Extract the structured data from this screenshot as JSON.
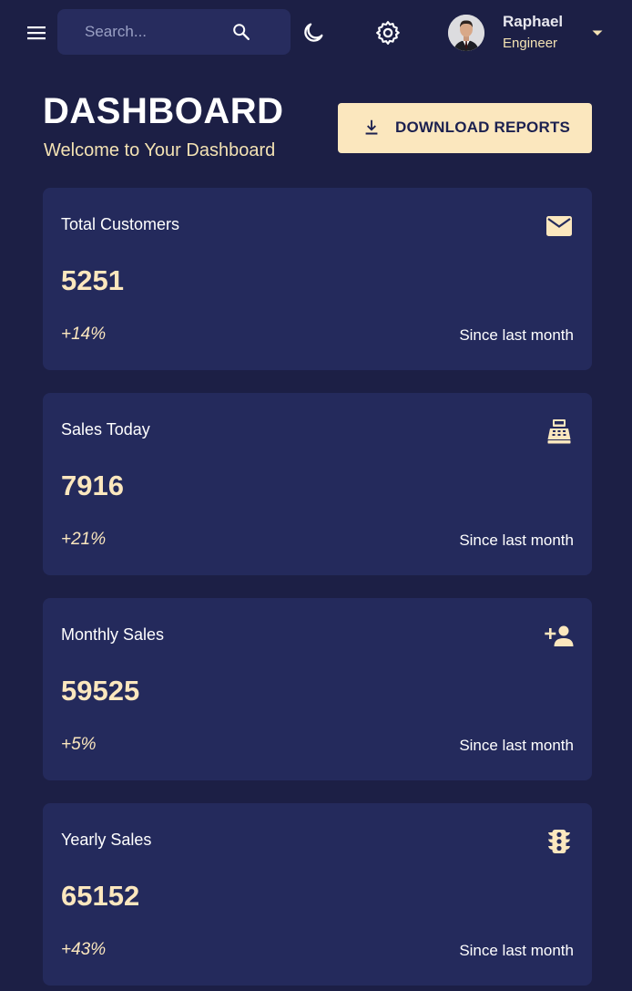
{
  "colors": {
    "background": "#1c1f45",
    "card": "#242a5c",
    "search_bg": "#272c5e",
    "accent": "#fbe7be",
    "accent_text": "#1c2150",
    "text": "#ffffff"
  },
  "topbar": {
    "menu_icon": "hamburger-menu-icon",
    "search": {
      "placeholder": "Search...",
      "value": "",
      "icon": "search-icon"
    },
    "theme_icon": "moon-icon",
    "settings_icon": "gear-icon",
    "profile": {
      "name": "Raphael",
      "role": "Engineer",
      "avatar_icon": "avatar",
      "caret_icon": "caret-down-icon"
    }
  },
  "header": {
    "title": "DASHBOARD",
    "subtitle": "Welcome to Your Dashboard",
    "download_button": {
      "label": "DOWNLOAD REPORTS",
      "icon": "download-icon"
    }
  },
  "cards": [
    {
      "title": "Total Customers",
      "value": "5251",
      "change": "+14%",
      "since": "Since last month",
      "icon": "email-icon"
    },
    {
      "title": "Sales Today",
      "value": "7916",
      "change": "+21%",
      "since": "Since last month",
      "icon": "point-of-sale-icon"
    },
    {
      "title": "Monthly Sales",
      "value": "59525",
      "change": "+5%",
      "since": "Since last month",
      "icon": "person-add-icon"
    },
    {
      "title": "Yearly Sales",
      "value": "65152",
      "change": "+43%",
      "since": "Since last month",
      "icon": "traffic-icon"
    }
  ]
}
